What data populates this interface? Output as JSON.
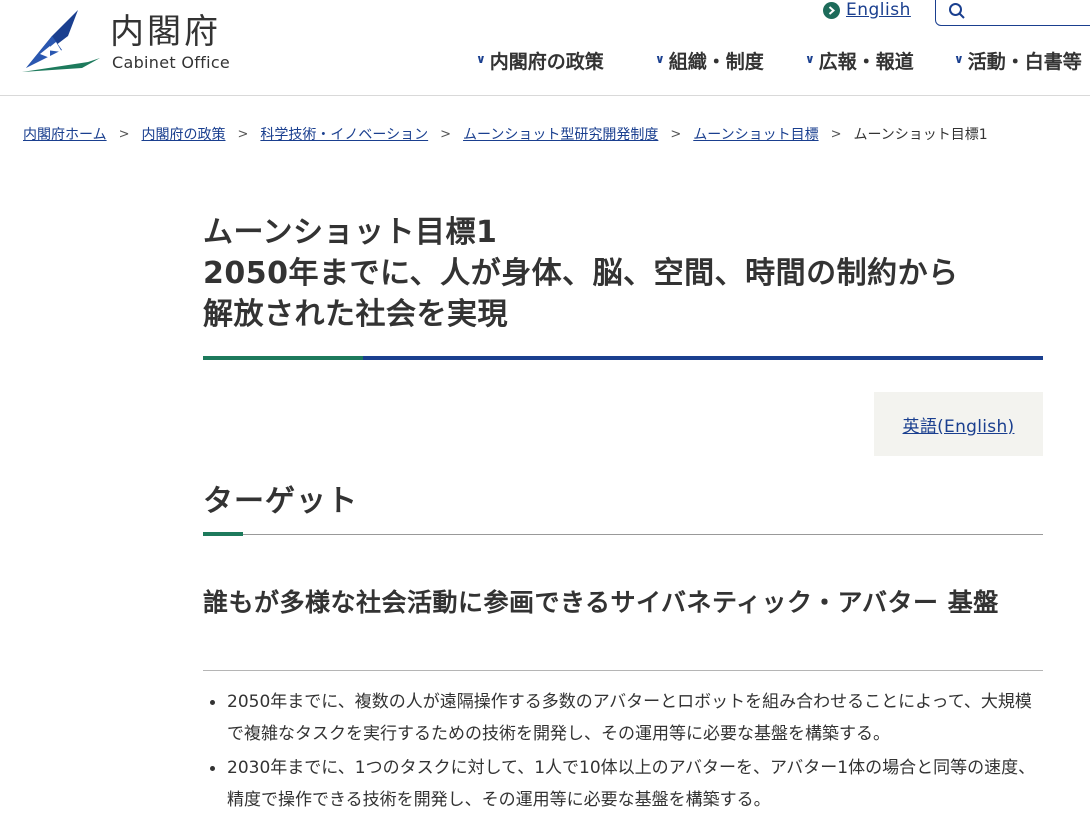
{
  "header": {
    "logo_jp": "内閣府",
    "logo_en": "Cabinet Office",
    "lang_link": "English",
    "search_placeholder": "",
    "nav": [
      {
        "label": "内閣府の政策"
      },
      {
        "label": "組織・制度"
      },
      {
        "label": "広報・報道"
      },
      {
        "label": "活動・白書等"
      }
    ]
  },
  "breadcrumb": {
    "items": [
      {
        "label": "内閣府ホーム"
      },
      {
        "label": "内閣府の政策"
      },
      {
        "label": "科学技術・イノベーション"
      },
      {
        "label": "ムーンショット型研究開発制度"
      },
      {
        "label": "ムーンショット目標"
      }
    ],
    "separator": ">",
    "current": "ムーンショット目標1"
  },
  "main": {
    "title_lines": [
      "ムーンショット目標1",
      "2050年までに、人が身体、脳、空間、時間の制約から",
      "解放された社会を実現"
    ],
    "english_link": "英語(English)",
    "section_heading": "ターゲット",
    "subsection_heading": "誰もが多様な社会活動に参画できるサイバネティック・アバター 基盤",
    "bullets": [
      "2050年までに、複数の人が遠隔操作する多数のアバターとロボットを組み合わせることによって、大規模で複雑なタスクを実行するための技術を開発し、その運用等に必要な基盤を構築する。",
      "2030年までに、1つのタスクに対して、1人で10体以上のアバターを、アバター1体の場合と同等の速度、精度で操作できる技術を開発し、その運用等に必要な基盤を構築する。"
    ]
  },
  "colors": {
    "link": "#1a3f8f",
    "accent_green": "#1d7a5c",
    "rule_blue": "#1a3f8f",
    "text": "#333333"
  },
  "icons": {
    "logo": "cabinet-office-logo",
    "lang": "chevron-right-circle-icon",
    "search": "search-icon",
    "nav_chevron": "chevron-down-icon"
  }
}
